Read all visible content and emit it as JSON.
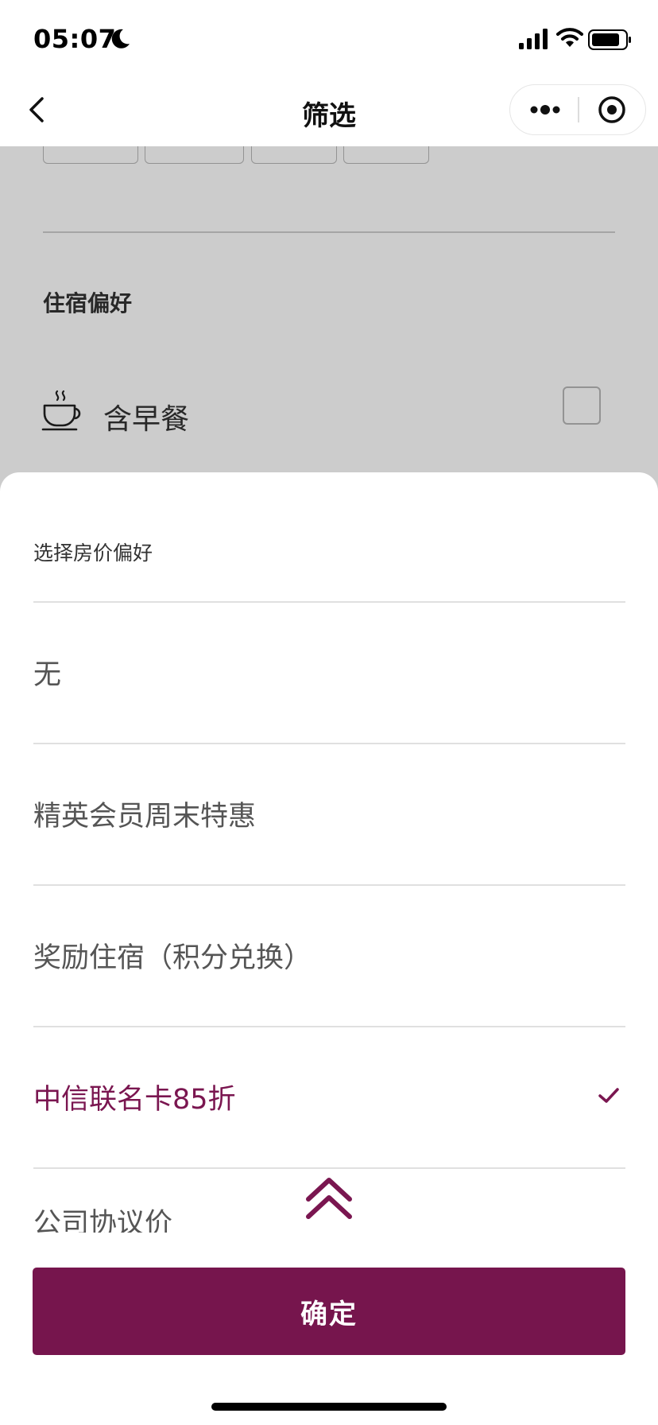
{
  "status_bar": {
    "time": "05:07",
    "icons": [
      "moon-icon",
      "signal-icon",
      "wifi-icon",
      "battery-icon"
    ]
  },
  "nav": {
    "title": "筛选",
    "icons": [
      "back-icon",
      "more-icon",
      "close-target-icon"
    ]
  },
  "background_page": {
    "section_title": "住宿偏好",
    "option_label": "含早餐",
    "option_icon": "coffee-cup-icon",
    "option_checked": false
  },
  "sheet": {
    "title": "选择房价偏好",
    "options": [
      {
        "label": "无",
        "selected": false
      },
      {
        "label": "精英会员周末特惠",
        "selected": false
      },
      {
        "label": "奖励住宿（积分兑换）",
        "selected": false
      },
      {
        "label": "中信联名卡85折",
        "selected": true
      },
      {
        "label": "公司协议价",
        "selected": false
      }
    ],
    "confirm_label": "确定"
  },
  "colors": {
    "accent": "#76154d",
    "selected_text": "#7a1650",
    "text": "#555555",
    "divider": "#e0e0e0"
  }
}
